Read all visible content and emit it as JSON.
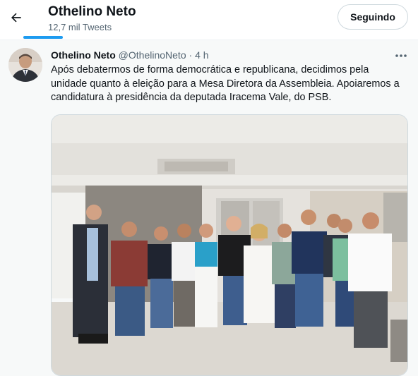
{
  "header": {
    "back_icon": "arrow-left-icon",
    "profile_name": "Othelino Neto",
    "tweet_count": "12,7 mil Tweets",
    "follow_label": "Seguindo",
    "accent_color": "#1d9bf0"
  },
  "tweet": {
    "author_name": "Othelino Neto",
    "author_handle": "@OthelinoNeto",
    "separator": "·",
    "time": "4 h",
    "more_icon": "more-horizontal-icon",
    "text": "Após debatermos de forma democrática e republicana, decidimos pela unidade quanto à eleição para a Mesa Diretora da Assembleia. Apoiaremos a candidatura à presidência da deputada Iracema Vale, do PSB.",
    "media_description": "group-photo"
  }
}
